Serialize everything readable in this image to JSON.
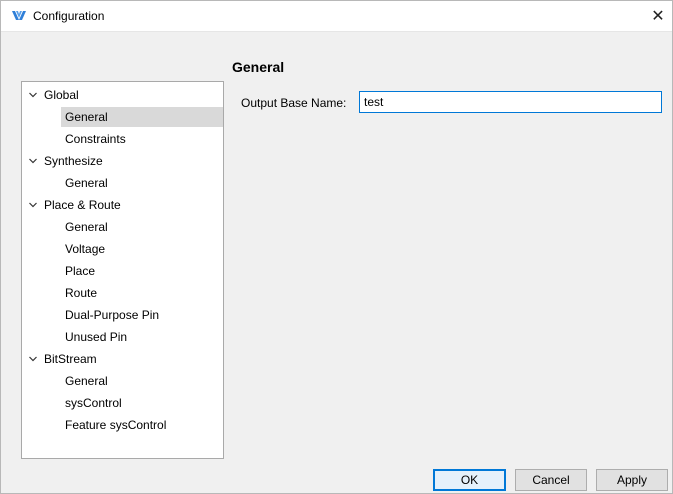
{
  "window": {
    "title": "Configuration",
    "close_glyph": "✕",
    "icon": "app-logo-icon"
  },
  "tree": {
    "items": [
      {
        "label": "Global",
        "level": 0,
        "expanded": true
      },
      {
        "label": "General",
        "level": 1,
        "selected": true
      },
      {
        "label": "Constraints",
        "level": 1
      },
      {
        "label": "Synthesize",
        "level": 0,
        "expanded": true
      },
      {
        "label": "General",
        "level": 1
      },
      {
        "label": "Place & Route",
        "level": 0,
        "expanded": true
      },
      {
        "label": "General",
        "level": 1
      },
      {
        "label": "Voltage",
        "level": 1
      },
      {
        "label": "Place",
        "level": 1
      },
      {
        "label": "Route",
        "level": 1
      },
      {
        "label": "Dual-Purpose Pin",
        "level": 1
      },
      {
        "label": "Unused Pin",
        "level": 1
      },
      {
        "label": "BitStream",
        "level": 0,
        "expanded": true
      },
      {
        "label": "General",
        "level": 1
      },
      {
        "label": "sysControl",
        "level": 1
      },
      {
        "label": "Feature sysControl",
        "level": 1
      }
    ]
  },
  "panel": {
    "title": "General",
    "output_base_name_label": "Output Base Name:",
    "output_base_name_value": "test"
  },
  "buttons": {
    "ok": "OK",
    "cancel": "Cancel",
    "apply": "Apply"
  },
  "colors": {
    "accent": "#0078d7",
    "selection": "#d9d9d9",
    "logo": "#2f7fd8"
  }
}
